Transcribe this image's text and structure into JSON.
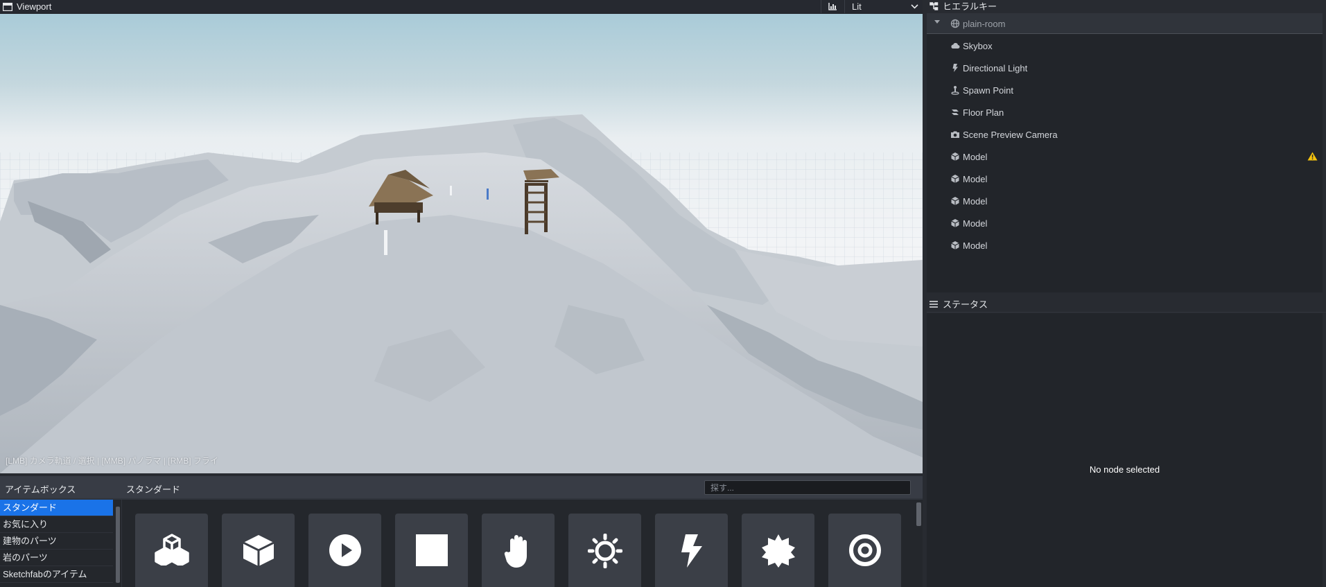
{
  "viewport": {
    "title": "Viewport",
    "render_mode": "Lit",
    "stats_icon": "chart-icon",
    "hint": "[LMB] カメラ軌道 / 選択 | [MMB] パノラマ | [RMB] フライ"
  },
  "itembox": {
    "title": "アイテムボックス",
    "section": "スタンダード",
    "search_placeholder": "探す...",
    "categories": [
      "スタンダード",
      "お気に入り",
      "建物のパーツ",
      "岩のパーツ",
      "Sketchfabのアイテム"
    ],
    "items": [
      {
        "icon": "cubes-icon"
      },
      {
        "icon": "box-icon"
      },
      {
        "icon": "play-icon"
      },
      {
        "icon": "square-icon"
      },
      {
        "icon": "hand-icon"
      },
      {
        "icon": "sun-icon"
      },
      {
        "icon": "bolt-icon"
      },
      {
        "icon": "burst-icon"
      },
      {
        "icon": "target-icon"
      }
    ]
  },
  "hierarchy": {
    "title": "ヒエラルキー",
    "nodes": [
      {
        "label": "plain-room",
        "icon": "globe-icon"
      },
      {
        "label": "Skybox",
        "icon": "cloud-icon"
      },
      {
        "label": "Directional Light",
        "icon": "bolt-icon"
      },
      {
        "label": "Spawn Point",
        "icon": "person-pin-icon"
      },
      {
        "label": "Floor Plan",
        "icon": "floor-plan-icon"
      },
      {
        "label": "Scene Preview Camera",
        "icon": "camera-icon"
      },
      {
        "label": "Model",
        "icon": "cube-icon",
        "warning": true
      },
      {
        "label": "Model",
        "icon": "cube-icon"
      },
      {
        "label": "Model",
        "icon": "cube-icon"
      },
      {
        "label": "Model",
        "icon": "cube-icon"
      },
      {
        "label": "Model",
        "icon": "cube-icon"
      }
    ]
  },
  "status": {
    "title": "ステータス",
    "empty_text": "No node selected"
  },
  "colors": {
    "accent": "#1a73e8",
    "warning": "#f4c20d",
    "panel": "#22252a"
  }
}
